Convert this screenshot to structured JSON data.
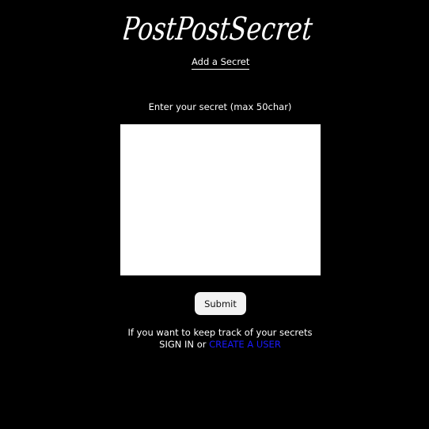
{
  "header": {
    "logo_text": "PostPostSecret",
    "add_secret_link": "Add a Secret"
  },
  "form": {
    "label": "Enter your secret (max 50char)",
    "textarea_value": "",
    "submit_label": "Submit"
  },
  "footer": {
    "track_text": "If you want to keep track of your secrets",
    "sign_in_link": "SIGN IN",
    "or_text": "or",
    "create_user_link": "CREATE A USER"
  },
  "colors": {
    "background": "#000000",
    "text": "#ffffff",
    "create_link": "#1a1aff"
  }
}
